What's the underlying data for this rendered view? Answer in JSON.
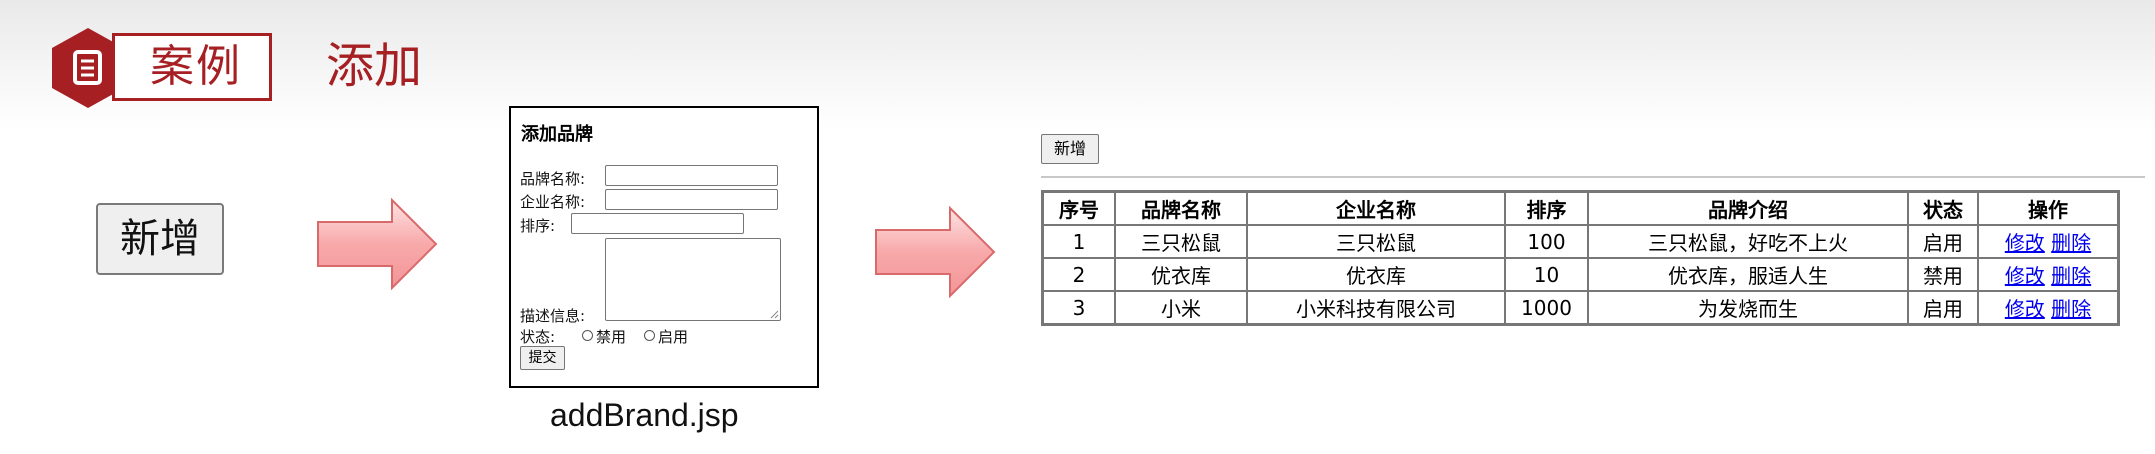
{
  "header": {
    "icon": "document-icon",
    "badge_label": "案例",
    "section_title": "添加",
    "accent_color": "#a61f22"
  },
  "big_button": {
    "label": "新增"
  },
  "form": {
    "title": "添加品牌",
    "brand_name_label": "品牌名称:",
    "company_name_label": "企业名称:",
    "order_label": "排序:",
    "description_label": "描述信息:",
    "status_label": "状态:",
    "status_options": [
      "禁用",
      "启用"
    ],
    "submit_label": "提交"
  },
  "caption": "addBrand.jsp",
  "list_page": {
    "add_button_label": "新增",
    "table": {
      "headers": [
        "序号",
        "品牌名称",
        "企业名称",
        "排序",
        "品牌介绍",
        "状态",
        "操作"
      ],
      "rows": [
        {
          "index": "1",
          "brand": "三只松鼠",
          "company": "三只松鼠",
          "order": "100",
          "intro": "三只松鼠，好吃不上火",
          "status": "启用",
          "edit": "修改",
          "delete": "删除"
        },
        {
          "index": "2",
          "brand": "优衣库",
          "company": "优衣库",
          "order": "10",
          "intro": "优衣库，服适人生",
          "status": "禁用",
          "edit": "修改",
          "delete": "删除"
        },
        {
          "index": "3",
          "brand": "小米",
          "company": "小米科技有限公司",
          "order": "1000",
          "intro": "为发烧而生",
          "status": "启用",
          "edit": "修改",
          "delete": "删除"
        }
      ]
    }
  }
}
